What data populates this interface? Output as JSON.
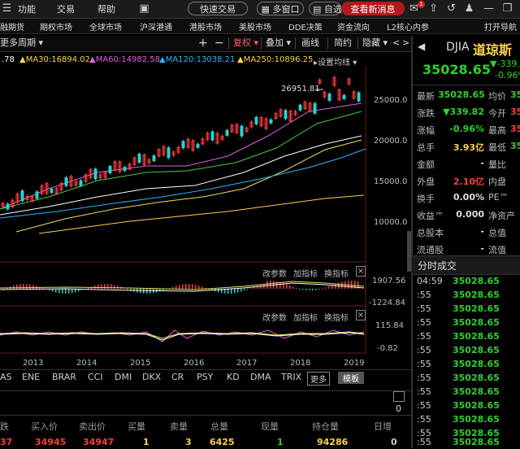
{
  "titlebar": {
    "menus": [
      "功能",
      "交易",
      "帮助"
    ],
    "quick_trade": "快速交易",
    "multi_window": "多窗口",
    "self_select": "自选",
    "view_news": "查看新消息",
    "mail_badge": "1"
  },
  "navbar": {
    "items": [
      "融期货",
      "期权市场",
      "全球市场",
      "沪深港通",
      "港股市场",
      "美股市场",
      "DDE决策",
      "资金流向",
      "L2核心内参",
      "打开导航"
    ]
  },
  "toolbar": {
    "period": "更多周期",
    "plus": "+",
    "minus": "−",
    "adjust": "复权",
    "overlay": "叠加",
    "draw": "画线",
    "simple": "简约",
    "hide": "隐藏",
    "left_arrow": "<",
    "right_arrow": ">"
  },
  "ma_legend": [
    {
      "text": ".78",
      "color": "#ffffff"
    },
    {
      "text": "MA30:16894.02",
      "color": "#ffd24a"
    },
    {
      "text": "MA60:14982.58",
      "color": "#e060e0"
    },
    {
      "text": "MA120:13038.21",
      "color": "#29b8ff"
    },
    {
      "text": "MA250:10896.25",
      "color": "#ffd24a"
    },
    {
      "text": "设置均线",
      "color": "#cccccc"
    }
  ],
  "main_axis": [
    "25000.0",
    "20000.0",
    "15000.0",
    "10000.0"
  ],
  "peak_label": "26951.81",
  "sub_buttons": [
    "改参数",
    "加指标",
    "换指标"
  ],
  "sub1_axis": [
    "1907.56",
    "-1224.84"
  ],
  "sub2_axis": [
    "115.84",
    "-0.82"
  ],
  "years": [
    "2013",
    "2014",
    "2015",
    "2016",
    "2017",
    "2018",
    "2019"
  ],
  "indicator_tabs": [
    "AS",
    "ENE",
    "BRAR",
    "CCI",
    "DMI",
    "DKX",
    "CR",
    "PSY",
    "KD",
    "DMA",
    "TRIX"
  ],
  "more": "更多",
  "template": "模板",
  "bottom_count": "0",
  "bottom_table": {
    "headers": [
      "跌",
      "买入价",
      "卖出价",
      "买量",
      "卖量",
      "总量",
      "现量",
      "持仓量",
      "日增"
    ],
    "values": [
      "37",
      "34945",
      "34947",
      "1",
      "3",
      "6425",
      "1",
      "94286",
      "0"
    ]
  },
  "quote": {
    "code": "DJIA",
    "name": "道琼斯",
    "price": "35028.65",
    "change": "-339.8",
    "change_pct": "-0.96%",
    "rows": [
      {
        "label": "最新",
        "value": "35028.65",
        "label2": "均价",
        "value2": "35"
      },
      {
        "label": "涨跌",
        "value": "▼339.82",
        "label2": "今开",
        "value2": "35"
      },
      {
        "label": "涨幅",
        "value": "-0.96%",
        "label2": "最高",
        "value2": "35"
      },
      {
        "label": "总手",
        "value": "3.93亿",
        "label2": "最低",
        "value2": "35"
      },
      {
        "label": "金额",
        "value": "-",
        "label2": "量比",
        "value2": ""
      },
      {
        "label": "外盘",
        "value": "2.10亿",
        "label2": "内盘",
        "value2": ""
      },
      {
        "label": "换手",
        "value": "0.00%",
        "label2": "PE™",
        "value2": ""
      },
      {
        "label": "收益™",
        "value": "0.000",
        "label2": "净资产",
        "value2": ""
      },
      {
        "label": "总股本",
        "value": "-",
        "label2": "总值",
        "value2": ""
      },
      {
        "label": "流通股",
        "value": "-",
        "label2": "流值",
        "value2": ""
      }
    ]
  },
  "ticks": {
    "title": "分时成交",
    "rows": [
      {
        "time": "04:59",
        "price": "35028.65"
      },
      {
        "time": ":55",
        "price": "35028.65"
      },
      {
        "time": ":55",
        "price": "35028.65"
      },
      {
        "time": ":55",
        "price": "35028.65"
      },
      {
        "time": ":55",
        "price": "35028.65"
      },
      {
        "time": ":55",
        "price": "35028.65"
      },
      {
        "time": ":55",
        "price": "35028.65"
      },
      {
        "time": ":55",
        "price": "35028.65"
      },
      {
        "time": ":55",
        "price": "35028.65"
      },
      {
        "time": ":55",
        "price": "35028.65"
      },
      {
        "time": ":55",
        "price": "35028.65"
      },
      {
        "time": ":55",
        "price": "35028.65"
      },
      {
        "time": ":55",
        "price": "35028.65"
      },
      {
        "time": ":55",
        "price": "35028.65"
      }
    ]
  },
  "colors": {
    "up": "#ff3b3b",
    "down": "#2fd12f",
    "accent_yellow": "#ffd24a",
    "accent_cyan": "#29b8ff"
  }
}
